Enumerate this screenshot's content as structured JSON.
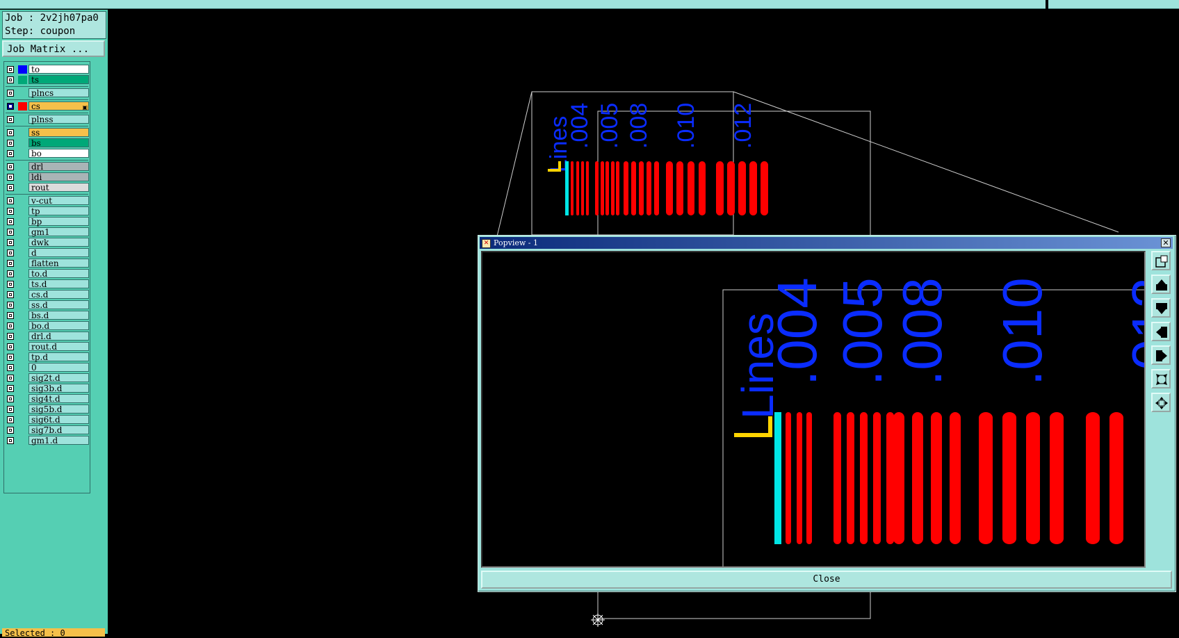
{
  "job": {
    "job_line": "Job : 2v2jh07pa0",
    "step_line": "Step: coupon"
  },
  "job_matrix_label": "Job Matrix ...",
  "layers": [
    {
      "name": "to",
      "color": "#ffffff",
      "swatch": "#0000ff",
      "checked": false
    },
    {
      "name": "ts",
      "color": "#00a878",
      "swatch": "#00a878",
      "checked": false
    },
    {
      "name": "plncs",
      "color": "#9ee3dc",
      "swatch": "",
      "checked": false
    },
    {
      "name": "cs",
      "color": "#f5c04a",
      "swatch": "#ff0000",
      "checked": true,
      "marker": "▣"
    },
    {
      "name": "plnss",
      "color": "#9ee3dc",
      "swatch": "",
      "checked": false
    },
    {
      "name": "ss",
      "color": "#f5c04a",
      "swatch": "",
      "checked": false
    },
    {
      "name": "bs",
      "color": "#00a878",
      "swatch": "",
      "checked": false
    },
    {
      "name": "bo",
      "color": "#ffffff",
      "swatch": "",
      "checked": false
    },
    {
      "name": "drl",
      "color": "#a9b4b6",
      "swatch": "",
      "checked": false
    },
    {
      "name": "ldi",
      "color": "#a9b4b6",
      "swatch": "",
      "checked": false
    },
    {
      "name": "rout",
      "color": "#dcdcdc",
      "swatch": "",
      "checked": false
    },
    {
      "name": "v-cut",
      "color": "#9ee3dc",
      "swatch": "",
      "checked": false
    },
    {
      "name": "tp",
      "color": "#9ee3dc",
      "swatch": "",
      "checked": false
    },
    {
      "name": "bp",
      "color": "#9ee3dc",
      "swatch": "",
      "checked": false
    },
    {
      "name": "gm1",
      "color": "#9ee3dc",
      "swatch": "",
      "checked": false
    },
    {
      "name": "dwk",
      "color": "#9ee3dc",
      "swatch": "",
      "checked": false
    },
    {
      "name": "d",
      "color": "#9ee3dc",
      "swatch": "",
      "checked": false
    },
    {
      "name": "flatten",
      "color": "#9ee3dc",
      "swatch": "",
      "checked": false
    },
    {
      "name": "to.d",
      "color": "#9ee3dc",
      "swatch": "",
      "checked": false
    },
    {
      "name": "ts.d",
      "color": "#9ee3dc",
      "swatch": "",
      "checked": false
    },
    {
      "name": "cs.d",
      "color": "#9ee3dc",
      "swatch": "",
      "checked": false
    },
    {
      "name": "ss.d",
      "color": "#9ee3dc",
      "swatch": "",
      "checked": false
    },
    {
      "name": "bs.d",
      "color": "#9ee3dc",
      "swatch": "",
      "checked": false
    },
    {
      "name": "bo.d",
      "color": "#9ee3dc",
      "swatch": "",
      "checked": false
    },
    {
      "name": "drl.d",
      "color": "#9ee3dc",
      "swatch": "",
      "checked": false
    },
    {
      "name": "rout.d",
      "color": "#9ee3dc",
      "swatch": "",
      "checked": false
    },
    {
      "name": "tp.d",
      "color": "#9ee3dc",
      "swatch": "",
      "checked": false
    },
    {
      "name": "0",
      "color": "#9ee3dc",
      "swatch": "",
      "checked": false
    },
    {
      "name": "sig2t.d",
      "color": "#9ee3dc",
      "swatch": "",
      "checked": false
    },
    {
      "name": "sig3b.d",
      "color": "#9ee3dc",
      "swatch": "",
      "checked": false
    },
    {
      "name": "sig4t.d",
      "color": "#9ee3dc",
      "swatch": "",
      "checked": false
    },
    {
      "name": "sig5b.d",
      "color": "#9ee3dc",
      "swatch": "",
      "checked": false
    },
    {
      "name": "sig6t.d",
      "color": "#9ee3dc",
      "swatch": "",
      "checked": false
    },
    {
      "name": "sig7b.d",
      "color": "#9ee3dc",
      "swatch": "",
      "checked": false
    },
    {
      "name": "gm1.d",
      "color": "#9ee3dc",
      "swatch": "",
      "checked": false
    }
  ],
  "selected_label": "Selected : 0",
  "coupon": {
    "title": "Lines",
    "widths": [
      ".004",
      ".005",
      ".008",
      ".010",
      ".012"
    ]
  },
  "popview": {
    "title": "Popview - 1",
    "close_label": "Close",
    "tools": [
      "zoom-window-icon",
      "pan-up-icon",
      "pan-down-icon",
      "pan-left-icon",
      "pan-right-icon",
      "zoom-out-icon",
      "zoom-in-icon"
    ]
  },
  "colors": {
    "trace": "#ff0000",
    "label": "#0a2cff",
    "highlight": "#00e5e5",
    "marker": "#ffd400"
  }
}
